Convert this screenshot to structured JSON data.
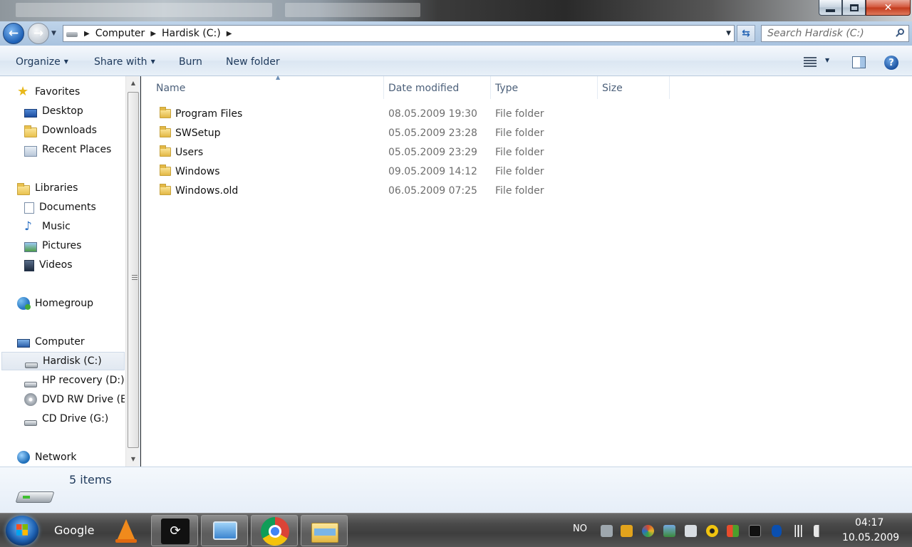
{
  "window": {
    "controls": {
      "minimize": "minimize-icon",
      "maximize": "restore-icon",
      "close": "✕"
    }
  },
  "address": {
    "crumbs": [
      "Computer",
      "Hardisk (C:)"
    ],
    "search_placeholder": "Search Hardisk (C:)"
  },
  "toolbar": {
    "organize": "Organize",
    "share_with": "Share with",
    "burn": "Burn",
    "new_folder": "New folder"
  },
  "nav": {
    "favorites": "Favorites",
    "desktop": "Desktop",
    "downloads": "Downloads",
    "recent_places": "Recent Places",
    "libraries": "Libraries",
    "documents": "Documents",
    "music": "Music",
    "pictures": "Pictures",
    "videos": "Videos",
    "homegroup": "Homegroup",
    "computer": "Computer",
    "hardisk": "Hardisk (C:)",
    "hp_recovery": "HP recovery (D:)",
    "dvd_rw": "DVD RW Drive (E:",
    "cd_drive": "CD Drive (G:)",
    "network": "Network"
  },
  "columns": {
    "name": "Name",
    "date": "Date modified",
    "type": "Type",
    "size": "Size"
  },
  "files": [
    {
      "name": "Program Files",
      "date": "08.05.2009 19:30",
      "type": "File folder"
    },
    {
      "name": "SWSetup",
      "date": "05.05.2009 23:28",
      "type": "File folder"
    },
    {
      "name": "Users",
      "date": "05.05.2009 23:29",
      "type": "File folder"
    },
    {
      "name": "Windows",
      "date": "09.05.2009 14:12",
      "type": "File folder"
    },
    {
      "name": "Windows.old",
      "date": "06.05.2009 07:25",
      "type": "File folder"
    }
  ],
  "details": {
    "count": "5 items"
  },
  "taskbar": {
    "google": "Google",
    "steam_glyph": "⟳",
    "language": "NO",
    "time": "04:17",
    "date": "10.05.2009"
  },
  "icons": {
    "back": "←",
    "forward": "→",
    "refresh": "⇆",
    "help": "?"
  },
  "colors": {
    "toolbar_text": "#1e395b",
    "selected_bg": "#e1e8f1"
  }
}
